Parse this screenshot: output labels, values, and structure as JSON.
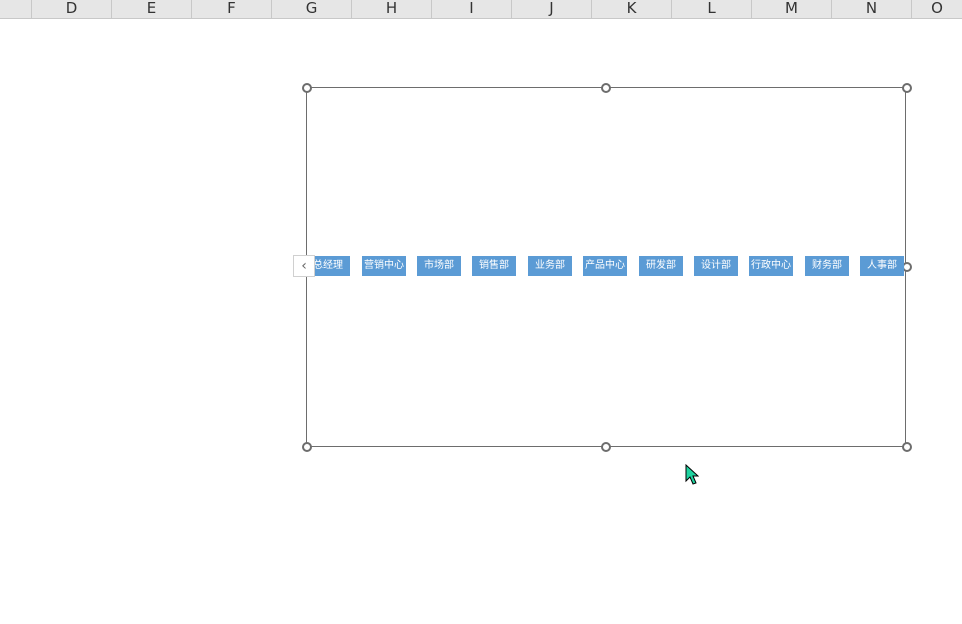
{
  "columns": [
    "D",
    "E",
    "F",
    "G",
    "H",
    "I",
    "J",
    "K",
    "L",
    "M",
    "N",
    "O"
  ],
  "tags": [
    "总经理",
    "营销中心",
    "市场部",
    "销售部",
    "业务部",
    "产品中心",
    "研发部",
    "设计部",
    "行政中心",
    "财务部",
    "人事部"
  ],
  "icons": {
    "scroll_left": "chevron-left-icon",
    "cursor": "mouse-pointer-icon"
  },
  "colors": {
    "tag_bg": "#5b9bd5",
    "tag_text": "#ffffff",
    "frame": "#6d6d6d",
    "header_bg": "#e6e6e6",
    "cursor_fill": "#1fd3a0"
  }
}
